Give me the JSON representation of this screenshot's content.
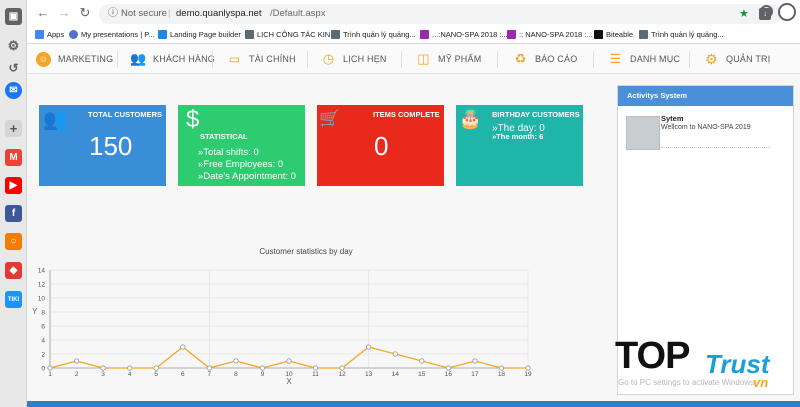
{
  "browser": {
    "security_label": "Not secure",
    "url_host": "demo.quanlyspa.net",
    "url_path": "/Default.aspx",
    "bookmarks": [
      {
        "label": "Apps",
        "icon": "apps-grid-icon",
        "color": "#4285f4"
      },
      {
        "label": "My presentations | P...",
        "icon": "globe-icon",
        "color": "#4e73c8"
      },
      {
        "label": "Landing Page builder",
        "icon": "landing-icon",
        "color": "#1e88e5"
      },
      {
        "label": "LỊCH CÔNG TÁC KIN...",
        "icon": "sheet-icon",
        "color": "#5c6b73"
      },
      {
        "label": "Trình quản lý quảng...",
        "icon": "ads-manager-icon",
        "color": "#5c6b73"
      },
      {
        "label": "...:NANO-SPA 2018 :...",
        "icon": "spa-icon",
        "color": "#9c27b0"
      },
      {
        "label": ":: NANO-SPA 2018 :...",
        "icon": "spa-icon",
        "color": "#9c27b0"
      },
      {
        "label": "Biteable",
        "icon": "biteable-icon",
        "color": "#111111"
      },
      {
        "label": "Trình quản lý quảng...",
        "icon": "ads-manager-icon",
        "color": "#5c6b73"
      }
    ]
  },
  "menu": {
    "items": [
      {
        "label": "MARKETING",
        "icon": "smile-icon"
      },
      {
        "label": "KHÁCH HÀNG",
        "icon": "users-icon"
      },
      {
        "label": "TÀI CHÍNH",
        "icon": "wallet-icon"
      },
      {
        "label": "LỊCH HẸN",
        "icon": "clock-icon"
      },
      {
        "label": "MỸ PHẨM",
        "icon": "box-icon"
      },
      {
        "label": "BÁO CÁO",
        "icon": "recycle-icon"
      },
      {
        "label": "DANH MỤC",
        "icon": "list-icon"
      },
      {
        "label": "QUẢN TRỊ",
        "icon": "gear-icon"
      }
    ]
  },
  "cards": {
    "customers": {
      "title": "TOTAL CUSTOMERS",
      "value": "150",
      "color": "#3a8ed8"
    },
    "statistical": {
      "title": "STATISTICAL",
      "lines": [
        "»Total shifts: 0",
        "»Free Employees: 0",
        "»Date's Appointment: 0"
      ],
      "color": "#2ecc71"
    },
    "items": {
      "title": "ITEMS COMPLETE",
      "value": "0",
      "color": "#e8291c"
    },
    "birthday": {
      "title": "BIRTHDAY CUSTOMERS",
      "day_label": "»The day: 0",
      "month_label": "»The month: 6",
      "color": "#1fb5a8"
    }
  },
  "activity": {
    "title": "Activitys System",
    "entries": [
      {
        "user": "Sytem",
        "message": "Wellcom to NANO-SPA 2019"
      }
    ]
  },
  "chart_data": {
    "type": "line",
    "title": "Customer statistics by day",
    "xlabel": "X",
    "ylabel": "Y",
    "ylim": [
      0,
      14
    ],
    "x": [
      1,
      2,
      3,
      4,
      5,
      6,
      7,
      8,
      9,
      10,
      11,
      12,
      13,
      14,
      15,
      16,
      17,
      18,
      19
    ],
    "series": [
      {
        "values": [
          0,
          1,
          0,
          0,
          0,
          3,
          0,
          1,
          0,
          1,
          0,
          0,
          3,
          2,
          1,
          0,
          1,
          0,
          0
        ],
        "color": "#f5a623"
      }
    ],
    "yticks": [
      0,
      2,
      4,
      6,
      8,
      10,
      12,
      14
    ],
    "grid": true
  },
  "watermark": "Go to PC settings to activate Windows.",
  "logo": {
    "text_top": "TOP",
    "text_trust": "Trust",
    "text_vn": "vn"
  }
}
